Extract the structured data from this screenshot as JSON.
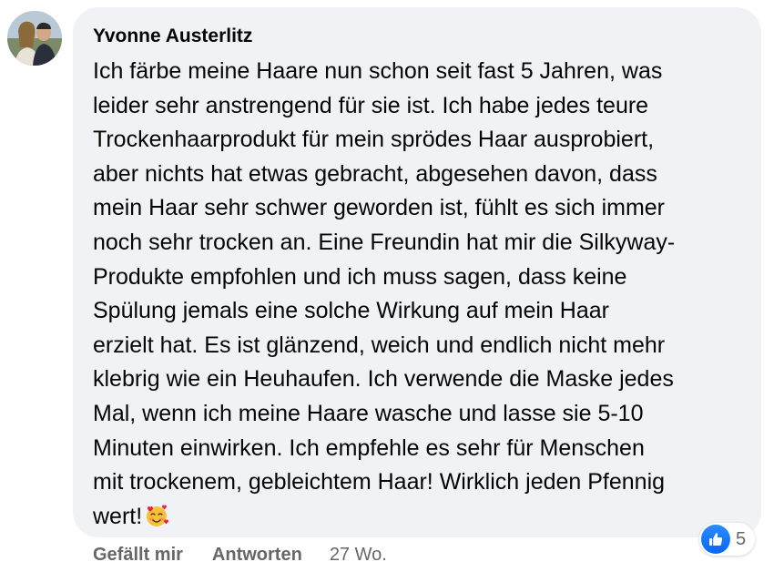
{
  "comment": {
    "author": "Yvonne Austerlitz",
    "body_lines": [
      "Ich färbe meine Haare nun schon seit fast 5 Jahren, was",
      "leider sehr anstrengend für sie ist. Ich habe jedes teure",
      "Trockenhaarprodukt für mein sprödes Haar ausprobiert,",
      "aber nichts hat etwas gebracht, abgesehen davon, dass",
      "mein Haar sehr schwer geworden ist, fühlt es sich immer",
      "noch sehr trocken an. Eine Freundin hat mir die Silkyway-",
      "Produkte empfohlen und ich muss sagen, dass keine",
      "Spülung jemals eine solche Wirkung auf mein Haar",
      "erzielt hat. Es ist glänzend, weich und endlich nicht mehr",
      "klebrig wie ein Heuhaufen. Ich verwende die Maske jedes",
      "Mal, wenn ich meine Haare wasche und lasse sie 5-10",
      "Minuten einwirken. Ich empfehle es sehr für Menschen",
      "mit trockenem, gebleichtem Haar! Wirklich jeden Pfennig",
      "wert!"
    ],
    "trailing_emoji": "smiling-face-with-hearts-icon",
    "reactions": {
      "icon": "like-icon",
      "count": "5"
    },
    "actions": {
      "like_label": "Gefällt mir",
      "reply_label": "Antworten",
      "timestamp": "27 Wo."
    }
  },
  "colors": {
    "bubble_background": "#f0f2f5",
    "text_primary": "#050505",
    "text_secondary": "#65676b",
    "like_blue": "#0866ff"
  }
}
